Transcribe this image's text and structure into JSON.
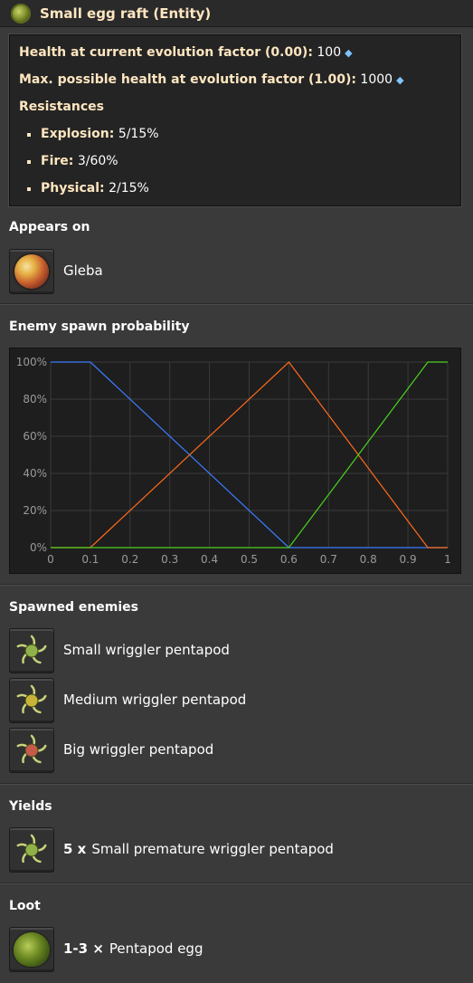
{
  "header": {
    "title": "Small egg raft (Entity)",
    "icon": "egg-raft-icon"
  },
  "stats": {
    "health_label": "Health at current evolution factor (0.00):",
    "health_value": "100",
    "max_health_label": "Max. possible health at evolution factor (1.00):",
    "max_health_value": "1000",
    "resistances_label": "Resistances",
    "resistances": [
      {
        "name": "Explosion:",
        "value": "5/15%"
      },
      {
        "name": "Fire:",
        "value": "3/60%"
      },
      {
        "name": "Physical:",
        "value": "2/15%"
      }
    ]
  },
  "appears_on": {
    "title": "Appears on",
    "planet": "Gleba",
    "icon": "gleba-planet-icon"
  },
  "spawn_chart": {
    "title": "Enemy spawn probability"
  },
  "chart_data": {
    "type": "line",
    "title": "",
    "xlabel": "",
    "ylabel": "",
    "x_ticks": [
      "0",
      "0.1",
      "0.2",
      "0.3",
      "0.4",
      "0.5",
      "0.6",
      "0.7",
      "0.8",
      "0.9",
      "1"
    ],
    "y_ticks": [
      "0%",
      "20%",
      "40%",
      "60%",
      "80%",
      "100%"
    ],
    "xlim": [
      0,
      1
    ],
    "ylim": [
      0,
      100
    ],
    "grid": true,
    "series": [
      {
        "color": "#3a7dff",
        "x": [
          0,
          0.1,
          0.6,
          1
        ],
        "y": [
          100,
          100,
          0,
          0
        ]
      },
      {
        "color": "#ff6a1a",
        "x": [
          0,
          0.1,
          0.6,
          0.95,
          1
        ],
        "y": [
          0,
          0,
          100,
          0,
          0
        ]
      },
      {
        "color": "#4bd21f",
        "x": [
          0,
          0.6,
          0.95,
          1
        ],
        "y": [
          0,
          0,
          100,
          100
        ]
      }
    ]
  },
  "spawned": {
    "title": "Spawned enemies",
    "items": [
      {
        "label": "Small wriggler pentapod",
        "icon": "small-wriggler-icon",
        "color": "#8fb14a"
      },
      {
        "label": "Medium wriggler pentapod",
        "icon": "medium-wriggler-icon",
        "color": "#c9b23a"
      },
      {
        "label": "Big wriggler pentapod",
        "icon": "big-wriggler-icon",
        "color": "#c65a4a"
      }
    ]
  },
  "yields": {
    "title": "Yields",
    "quantity": "5 x",
    "label": "Small premature wriggler pentapod",
    "icon": "premature-wriggler-icon"
  },
  "loot": {
    "title": "Loot",
    "quantity": "1-3 ×",
    "label": "Pentapod egg",
    "icon": "pentapod-egg-icon"
  },
  "colors": {
    "accent_text": "#ffe6c0",
    "diamond": "#7fc3ff"
  }
}
